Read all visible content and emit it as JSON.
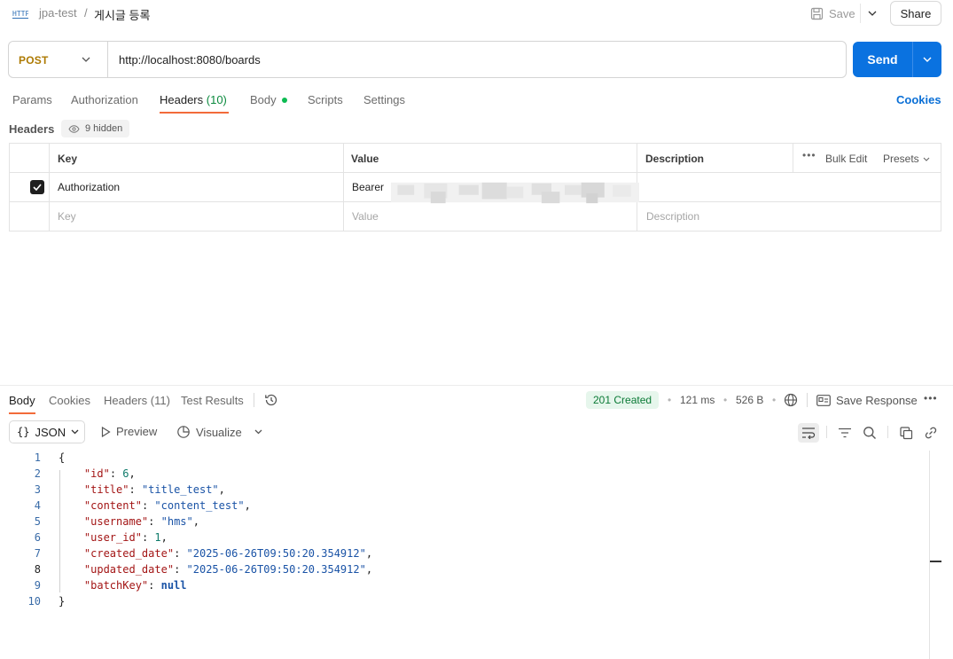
{
  "breadcrumb": {
    "collection": "jpa-test",
    "separator": "/",
    "request": "게시글 등록"
  },
  "topbar": {
    "save_label": "Save",
    "share_label": "Share"
  },
  "request": {
    "method": "POST",
    "url": "http://localhost:8080/boards",
    "send_label": "Send"
  },
  "tabs": [
    {
      "label": "Params"
    },
    {
      "label": "Authorization"
    },
    {
      "label": "Headers",
      "count": "(10)"
    },
    {
      "label": "Body"
    },
    {
      "label": "Scripts"
    },
    {
      "label": "Settings"
    }
  ],
  "cookies_link": "Cookies",
  "headers_section": {
    "title": "Headers",
    "hidden": "9 hidden"
  },
  "headers_table": {
    "columns": {
      "key": "Key",
      "value": "Value",
      "description": "Description"
    },
    "actions": {
      "bulk_edit": "Bulk Edit",
      "presets": "Presets"
    },
    "rows": [
      {
        "checked": true,
        "key": "Authorization",
        "value": "Bearer"
      }
    ],
    "placeholder": {
      "key": "Key",
      "value": "Value",
      "description": "Description"
    }
  },
  "response": {
    "tabs": [
      {
        "label": "Body"
      },
      {
        "label": "Cookies"
      },
      {
        "label": "Headers (11)"
      },
      {
        "label": "Test Results"
      }
    ],
    "status": "201 Created",
    "time": "121 ms",
    "size": "526 B",
    "save_response": "Save Response",
    "format": "JSON",
    "preview": "Preview",
    "visualize": "Visualize",
    "lines": [
      "1",
      "2",
      "3",
      "4",
      "5",
      "6",
      "7",
      "8",
      "9",
      "10"
    ],
    "body": {
      "id": 6,
      "title": "title_test",
      "content": "content_test",
      "username": "hms",
      "user_id": 1,
      "created_date": "2025-06-26T09:50:20.354912",
      "updated_date": "2025-06-26T09:50:20.354912",
      "batchKey": "null"
    }
  },
  "colors": {
    "send": "#0a72e0",
    "accent": "#f26b3a",
    "method": "#ad7a03",
    "status_ok": "#0b7a36"
  }
}
